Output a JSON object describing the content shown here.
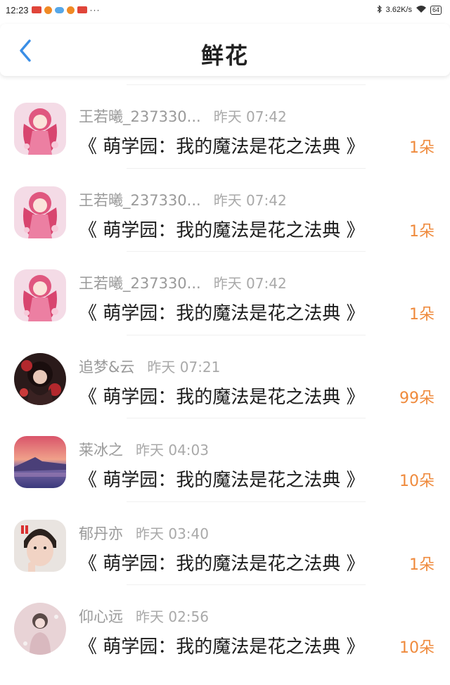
{
  "status_bar": {
    "time": "12:23",
    "more": "···",
    "net_speed": "3.62K/s",
    "battery": "64"
  },
  "header": {
    "title": "鲜花"
  },
  "colors": {
    "accent_blue": "#3a8ee6",
    "flower_count": "#ef8a3c"
  },
  "records": [
    {
      "name": "王若曦_237330...",
      "time": "昨天 07:42",
      "work": "《 萌学园：我的魔法是花之法典 》",
      "count": "1朵",
      "avatar": "anime-girl-pink"
    },
    {
      "name": "王若曦_237330...",
      "time": "昨天 07:42",
      "work": "《 萌学园：我的魔法是花之法典 》",
      "count": "1朵",
      "avatar": "anime-girl-pink"
    },
    {
      "name": "王若曦_237330...",
      "time": "昨天 07:42",
      "work": "《 萌学园：我的魔法是花之法典 》",
      "count": "1朵",
      "avatar": "anime-girl-pink"
    },
    {
      "name": "追梦&云",
      "time": "昨天 07:21",
      "work": "《 萌学园：我的魔法是花之法典 》",
      "count": "99朵",
      "avatar": "dark-portrait"
    },
    {
      "name": "莱冰之",
      "time": "昨天 04:03",
      "work": "《 萌学园：我的魔法是花之法典 》",
      "count": "10朵",
      "avatar": "sunset-mountain"
    },
    {
      "name": "郁丹亦",
      "time": "昨天 03:40",
      "work": "《 萌学园：我的魔法是花之法典 》",
      "count": "1朵",
      "avatar": "boy-photo"
    },
    {
      "name": "仰心远",
      "time": "昨天 02:56",
      "work": "《 萌学园：我的魔法是花之法典 》",
      "count": "10朵",
      "avatar": "pink-photo"
    }
  ]
}
